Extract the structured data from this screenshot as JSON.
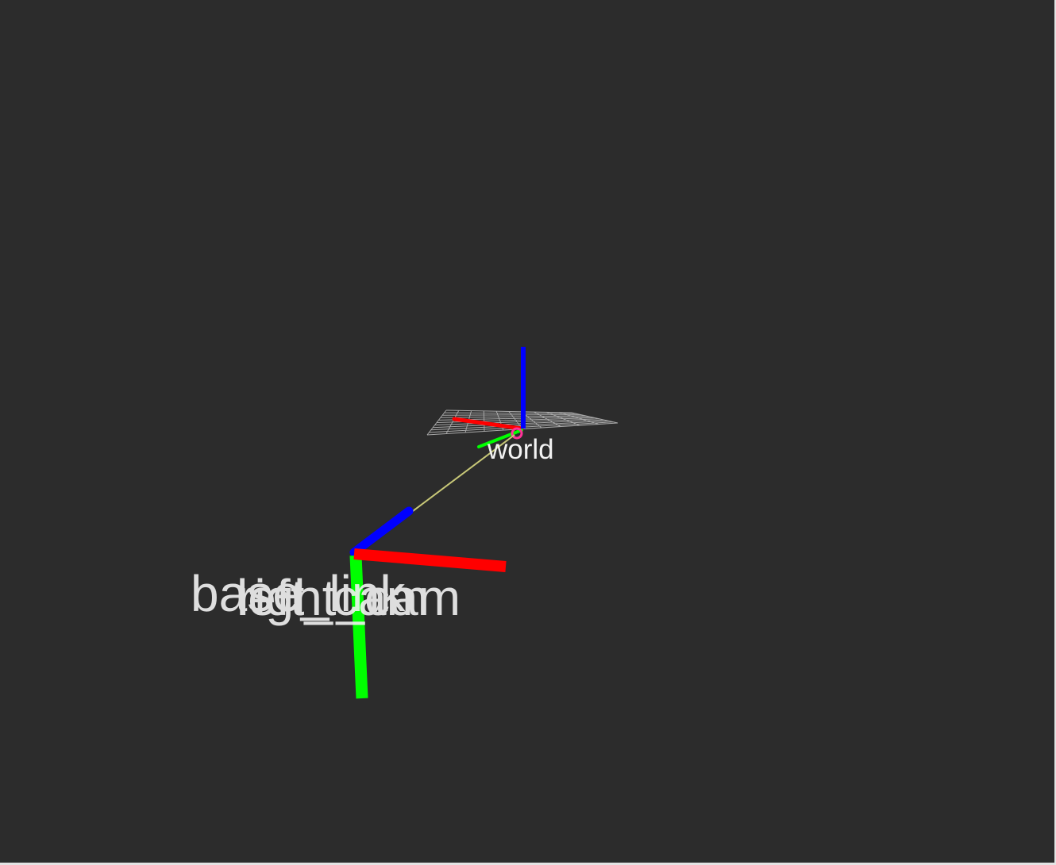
{
  "viewport": {
    "background_color": "#2c2c2c",
    "grid_color": "#a8a8a8"
  },
  "axes_colors": {
    "x": "#ff0000",
    "y": "#00ff00",
    "z": "#0000ff",
    "link": "#c8c878",
    "origin_marker": "#ff3399"
  },
  "frames": {
    "world": {
      "label": "world"
    },
    "overlapping": [
      {
        "label": "base_link"
      },
      {
        "label": "left_cam"
      },
      {
        "label": "right_cam"
      }
    ]
  }
}
